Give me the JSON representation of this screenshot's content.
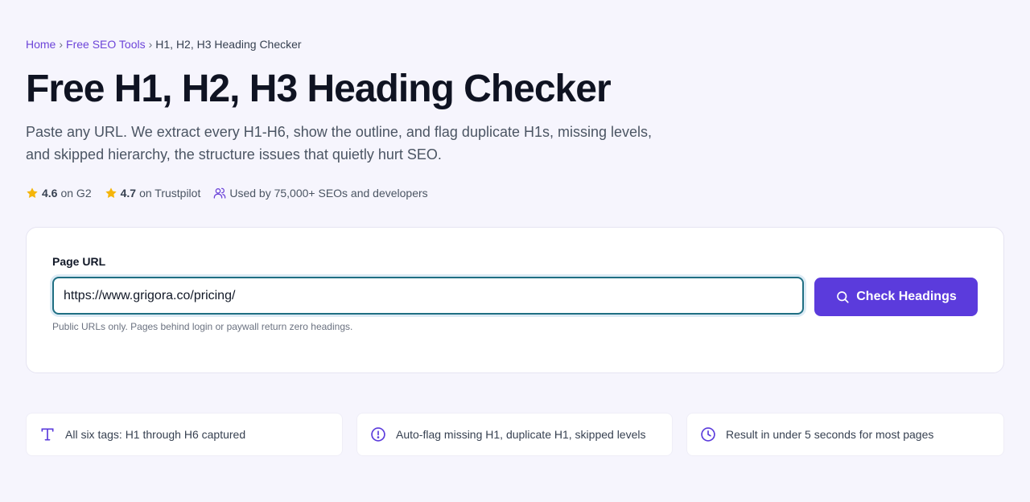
{
  "breadcrumb": {
    "home": "Home",
    "tools": "Free SEO Tools",
    "current": "H1, H2, H3 Heading Checker",
    "separator": "›"
  },
  "hero": {
    "title": "Free H1, H2, H3 Heading Checker",
    "subtitle": "Paste any URL. We extract every H1-H6, show the outline, and flag duplicate H1s, missing levels, and skipped hierarchy, the structure issues that quietly hurt SEO."
  },
  "social_proof": {
    "g2_rating": "4.6",
    "g2_label": "on G2",
    "trustpilot_rating": "4.7",
    "trustpilot_label": "on Trustpilot",
    "users_text": "Used by 75,000+ SEOs and developers"
  },
  "form": {
    "label": "Page URL",
    "url_value": "https://www.grigora.co/pricing/",
    "hint": "Public URLs only. Pages behind login or paywall return zero headings.",
    "button_label": "Check Headings"
  },
  "features": [
    {
      "icon": "type-icon",
      "text": "All six tags: H1 through H6 captured"
    },
    {
      "icon": "alert-circle-icon",
      "text": "Auto-flag missing H1, duplicate H1, skipped levels"
    },
    {
      "icon": "clock-icon",
      "text": "Result in under 5 seconds for most pages"
    }
  ],
  "colors": {
    "accent": "#5b3bdc",
    "link": "#6d45d9",
    "star": "#f5b50a",
    "background": "#f6f5fd"
  }
}
